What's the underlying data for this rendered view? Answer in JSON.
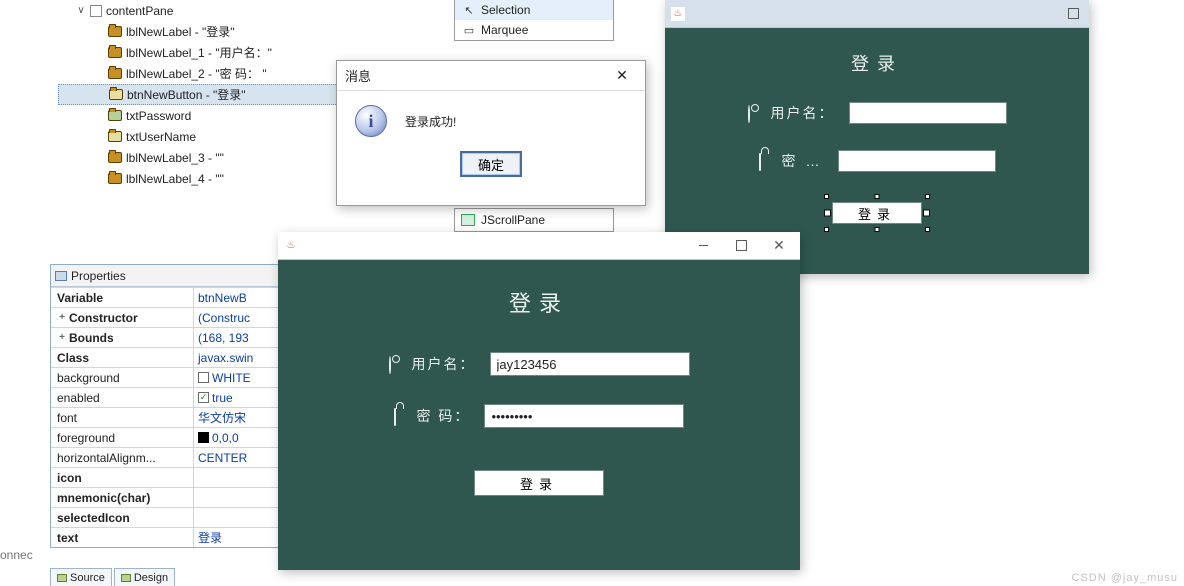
{
  "tree": {
    "root": "contentPane",
    "items": [
      "lblNewLabel - \"登录\"",
      "lblNewLabel_1 - \"用户名：\"",
      "lblNewLabel_2 - \"密   码： \"",
      "btnNewButton - \"登录\"",
      "txtPassword",
      "txtUserName",
      "lblNewLabel_3 - \"\"",
      "lblNewLabel_4 - \"\""
    ]
  },
  "palette": {
    "selection": "Selection",
    "marquee": "Marquee",
    "jscrollpane": "JScrollPane"
  },
  "dialog": {
    "title": "消息",
    "body": "登录成功!",
    "ok": "确定"
  },
  "properties": {
    "header": "Properties",
    "rows": {
      "variable": {
        "name": "Variable",
        "value": "btnNewB"
      },
      "constructor": {
        "name": "Constructor",
        "value": "(Construc"
      },
      "bounds": {
        "name": "Bounds",
        "value": "(168, 193"
      },
      "class": {
        "name": "Class",
        "value": "javax.swin"
      },
      "background": {
        "name": "background",
        "value": "WHITE"
      },
      "enabled": {
        "name": "enabled",
        "value": "true"
      },
      "font": {
        "name": "font",
        "value": "华文仿宋"
      },
      "foreground": {
        "name": "foreground",
        "value": "0,0,0"
      },
      "halign": {
        "name": "horizontalAlignm...",
        "value": "CENTER"
      },
      "icon": {
        "name": "icon",
        "value": ""
      },
      "mnemonic": {
        "name": "mnemonic(char)",
        "value": ""
      },
      "selectedIcon": {
        "name": "selectedIcon",
        "value": ""
      },
      "text": {
        "name": "text",
        "value": "登录"
      }
    }
  },
  "tabs": {
    "source": "Source",
    "design": "Design"
  },
  "truncated_left": "onnec",
  "login_a": {
    "title": "登录",
    "user_label": "用户名：",
    "pass_label": "密   码：",
    "user_value": "jay123456",
    "pass_value": "•••••••••",
    "button": "登录"
  },
  "login_b": {
    "title": "登录",
    "user_label": "用户名：",
    "pass_label_a": "密",
    "pass_label_b": "…",
    "button": "登录"
  },
  "watermark": "CSDN @jay_musu"
}
